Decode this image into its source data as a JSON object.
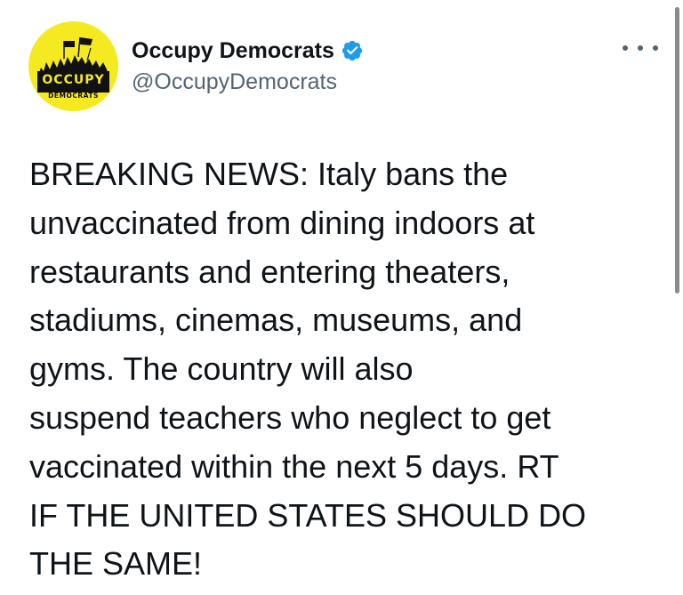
{
  "tweet": {
    "author": {
      "display_name": "Occupy Democrats",
      "handle": "@OccupyDemocrats",
      "verified": true,
      "avatar": {
        "icon": "occupy-democrats-logo",
        "background": "#f5ea20",
        "text_top": "OCCUPY",
        "text_bottom": "DEMOCRATS"
      }
    },
    "more_icon": "more-options-icon",
    "body_text": "BREAKING NEWS: Italy bans the\nunvaccinated from dining indoors at\nrestaurants and entering theaters,\nstadiums, cinemas, museums, and\ngyms. The country will also\nsuspend teachers who neglect to get\nvaccinated within the next 5 days. RT\nIF THE UNITED STATES SHOULD DO\nTHE SAME!"
  },
  "colors": {
    "text_primary": "#0f1419",
    "text_secondary": "#536471",
    "verified_blue": "#1d9bf0",
    "avatar_yellow": "#f5ea20"
  }
}
